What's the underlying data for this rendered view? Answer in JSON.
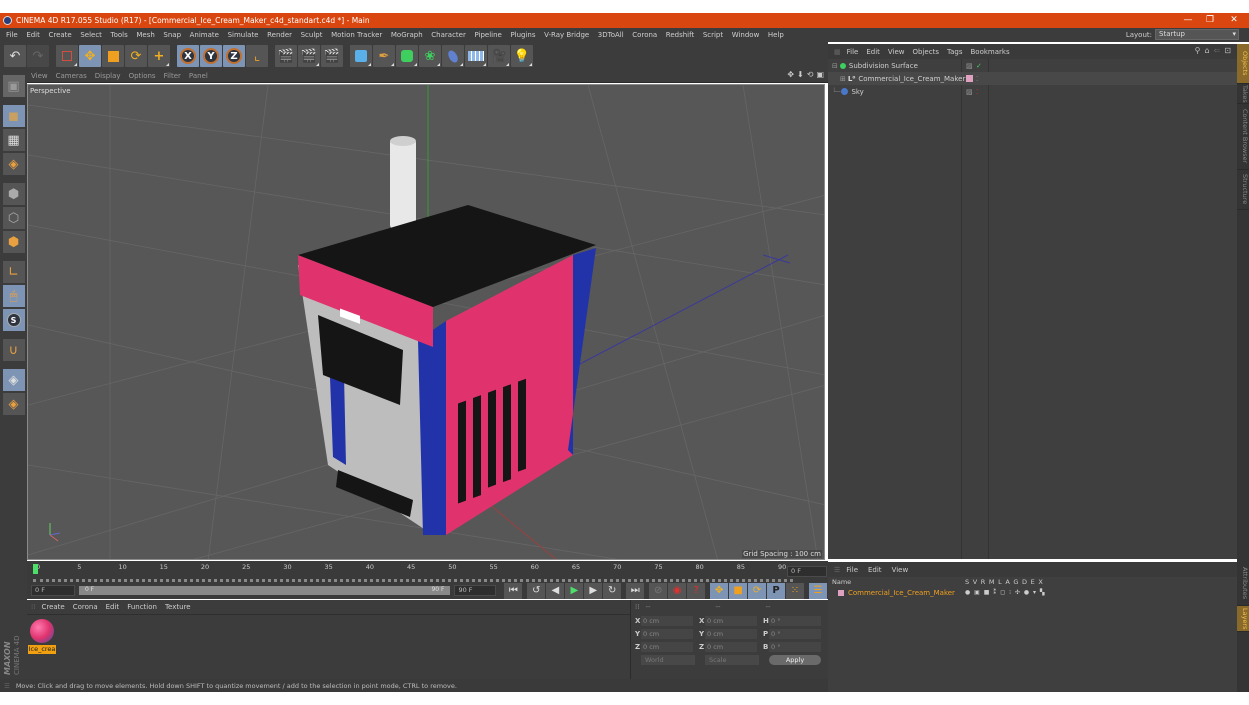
{
  "window": {
    "title": "CINEMA 4D R17.055 Studio (R17) - [Commercial_Ice_Cream_Maker_c4d_standart.c4d *] - Main",
    "controls": {
      "minimize": "—",
      "restore": "❐",
      "close": "✕"
    }
  },
  "menubar": {
    "items": [
      "File",
      "Edit",
      "Create",
      "Select",
      "Tools",
      "Mesh",
      "Snap",
      "Animate",
      "Simulate",
      "Render",
      "Sculpt",
      "Motion Tracker",
      "MoGraph",
      "Character",
      "Pipeline",
      "Plugins",
      "V-Ray Bridge",
      "3DToAll",
      "Corona",
      "Redshift",
      "Script",
      "Window",
      "Help"
    ],
    "layout_label": "Layout:",
    "layout_value": "Startup"
  },
  "toolbar": {
    "icons": [
      "undo-icon",
      "redo-icon",
      "live-selection-icon",
      "move-icon",
      "scale-icon",
      "rotate-icon",
      "add-icon",
      "x-axis-icon",
      "y-axis-icon",
      "z-axis-icon",
      "coordinate-system-icon",
      "render-view-icon",
      "render-picture-viewer-icon",
      "render-settings-icon",
      "cube-icon",
      "pen-icon",
      "subdivision-icon",
      "cloner-icon",
      "deformer-icon",
      "floor-icon",
      "camera-icon",
      "light-icon"
    ],
    "axis_labels": [
      "X",
      "Y",
      "Z"
    ]
  },
  "left_tools": [
    "make-editable-icon",
    "model-mode-icon",
    "texture-mode-icon",
    "workplane-icon",
    "point-mode-icon",
    "edge-mode-icon",
    "polygon-mode-icon",
    "axis-mode-icon",
    "tweak-mode-icon",
    "solo-icon",
    "snap-icon",
    "workplane-lock-icon",
    "workplane-snap-icon"
  ],
  "viewport": {
    "menu": [
      "View",
      "Cameras",
      "Display",
      "Options",
      "Filter",
      "Panel"
    ],
    "label": "Perspective",
    "grid_spacing": "Grid Spacing : 100 cm",
    "colors": {
      "pink": "#e0336e",
      "blue": "#2233aa",
      "black": "#151515",
      "white": "#e8e8e8",
      "grid_bg": "#575757"
    }
  },
  "timeline": {
    "ticks": [
      "0",
      "5",
      "10",
      "15",
      "20",
      "25",
      "30",
      "35",
      "40",
      "45",
      "50",
      "55",
      "60",
      "65",
      "70",
      "75",
      "80",
      "85",
      "90"
    ],
    "current_frame_field": "0 F",
    "start_field": "0 F",
    "range_start": "0 F",
    "range_end": "90 F",
    "end_field": "90 F"
  },
  "material_manager": {
    "menu": [
      "Create",
      "Corona",
      "Edit",
      "Function",
      "Texture"
    ],
    "materials": [
      {
        "name": "Ice_crea"
      }
    ]
  },
  "coordinates": {
    "headers": [
      "--",
      "--",
      "--"
    ],
    "rows": [
      {
        "a": "X",
        "av": "0 cm",
        "b": "X",
        "bv": "0 cm",
        "c": "H",
        "cv": "0 °"
      },
      {
        "a": "Y",
        "av": "0 cm",
        "b": "Y",
        "bv": "0 cm",
        "c": "P",
        "cv": "0 °"
      },
      {
        "a": "Z",
        "av": "0 cm",
        "b": "Z",
        "bv": "0 cm",
        "c": "B",
        "cv": "0 °"
      }
    ],
    "mode_select": "World",
    "scale_select": "Scale",
    "apply_label": "Apply"
  },
  "brand": {
    "line1": "MAXON",
    "line2": "CINEMA 4D"
  },
  "status": "Move: Click and drag to move elements. Hold down SHIFT to quantize movement / add to the selection in point mode, CTRL to remove.",
  "object_manager": {
    "menu": [
      "File",
      "Edit",
      "View",
      "Objects",
      "Tags",
      "Bookmarks"
    ],
    "objects": [
      {
        "name": "Subdivision Surface",
        "icon": "subdivision-icon",
        "color": "#3fcf5f"
      },
      {
        "name": "Commercial_Ice_Cream_Maker",
        "icon": "null-object-icon",
        "color": "#e0a0c0"
      },
      {
        "name": "Sky",
        "icon": "sky-icon",
        "color": "#4a78c8"
      }
    ]
  },
  "side_tabs_top": [
    "Objects",
    "Takes",
    "Content Browser",
    "Structure"
  ],
  "side_tabs_bottom": [
    "Attributes",
    "Layers"
  ],
  "layer_manager": {
    "menu": [
      "File",
      "Edit",
      "View"
    ],
    "columns": [
      "Name",
      "S",
      "V",
      "R",
      "M",
      "L",
      "A",
      "G",
      "D",
      "E",
      "X"
    ],
    "layers": [
      {
        "name": "Commercial_Ice_Cream_Maker",
        "color": "#e0a0c0"
      }
    ]
  }
}
